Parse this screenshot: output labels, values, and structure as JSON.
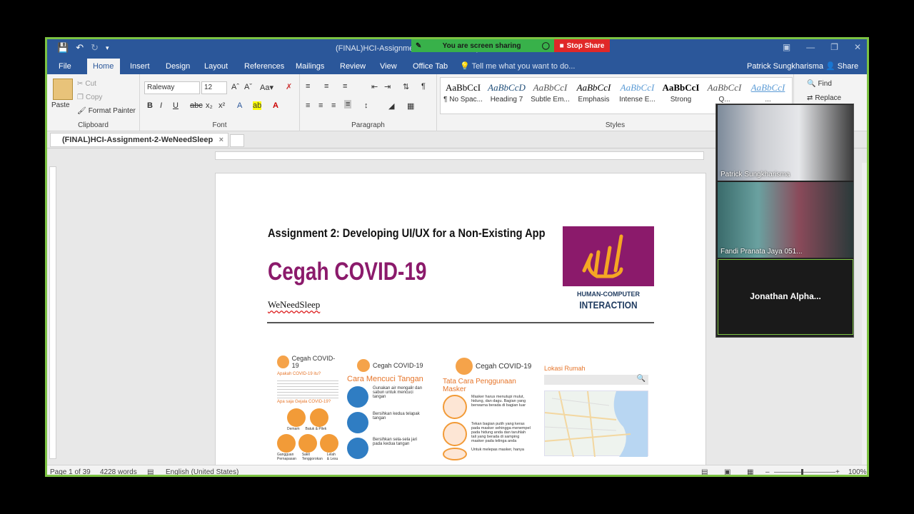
{
  "window": {
    "title": "(FINAL)HCI-Assignment-2-WeNeedSleep",
    "qat": [
      "save-icon",
      "undo-icon",
      "redo-icon",
      "customize-icon"
    ]
  },
  "screen_share": {
    "status": "You are screen sharing",
    "stop_label": "Stop Share"
  },
  "tabs": [
    "File",
    "Home",
    "Insert",
    "Design",
    "Layout",
    "References",
    "Mailings",
    "Review",
    "View",
    "Office Tab"
  ],
  "tell_me": "Tell me what you want to do...",
  "user": "Patrick Sungkharisma",
  "share_label": "Share",
  "ribbon": {
    "clipboard": {
      "paste": "Paste",
      "cut": "Cut",
      "copy": "Copy",
      "format_painter": "Format Painter",
      "label": "Clipboard"
    },
    "font": {
      "name": "Raleway",
      "size": "12",
      "label": "Font"
    },
    "paragraph": {
      "label": "Paragraph"
    },
    "styles": {
      "label": "Styles",
      "items": [
        {
          "preview": "AaBbCcI",
          "name": "¶ No Spac..."
        },
        {
          "preview": "AaBbCcD",
          "name": "Heading 7"
        },
        {
          "preview": "AaBbCcI",
          "name": "Subtle Em..."
        },
        {
          "preview": "AaBbCcI",
          "name": "Emphasis"
        },
        {
          "preview": "AaBbCcI",
          "name": "Intense E..."
        },
        {
          "preview": "AaBbCcI",
          "name": "Strong"
        },
        {
          "preview": "AaBbCcI",
          "name": "Q..."
        },
        {
          "preview": "AaBbCcI",
          "name": "..."
        }
      ]
    },
    "editing": {
      "find": "Find",
      "replace": "Replace"
    }
  },
  "doc_tab": "(FINAL)HCI-Assignment-2-WeNeedSleep",
  "document": {
    "assignment_title": "Assignment 2: Developing UI/UX for a Non-Existing App",
    "app_title": "Cegah COVID-19",
    "team": "WeNeedSleep",
    "logo_line1": "HUMAN-COMPUTER",
    "logo_line2": "INTERACTION",
    "mockups": [
      {
        "brand": "Cegah COVID-19",
        "sub": "Apakah COVID-19 itu?",
        "sub2": "Apa saja Gejala COVID-19?",
        "symptoms": [
          "Demam",
          "Batuk & Pilek",
          "Gangguan Pernapasan",
          "Sakit Tenggorokan",
          "Lelah & Lesu"
        ]
      },
      {
        "brand": "Cegah COVID-19",
        "sub": "Cara Mencuci Tangan",
        "steps": [
          "Gunakan air mengalir dan sabun untuk mencuci tangan",
          "Bersihkan kedua telapak tangan",
          "Bersihkan sela-sela jari pada kedua tangan"
        ]
      },
      {
        "brand": "Cegah COVID-19",
        "sub": "Tata Cara Penggunaan Masker",
        "steps": [
          "Masker harus menutupi mulut, hidung, dan dagu. Bagian yang berwarna berada di bagian luar",
          "Tekan bagian putih yang keras pada masker sehingga menempel pada hidung anda dan taruhlah tali yang berada di samping masker pada telinga anda",
          "Untuk melepas masker, hanya"
        ]
      },
      {
        "brand": "",
        "sub": "Lokasi Rumah"
      }
    ]
  },
  "status": {
    "page": "Page 1 of 39",
    "words": "4228 words",
    "language": "English (United States)",
    "zoom": "100%"
  },
  "participants": [
    "Patrick Sungkharisma",
    "Fandi Pranata Jaya 051...",
    "Jonathan  Alpha..."
  ]
}
